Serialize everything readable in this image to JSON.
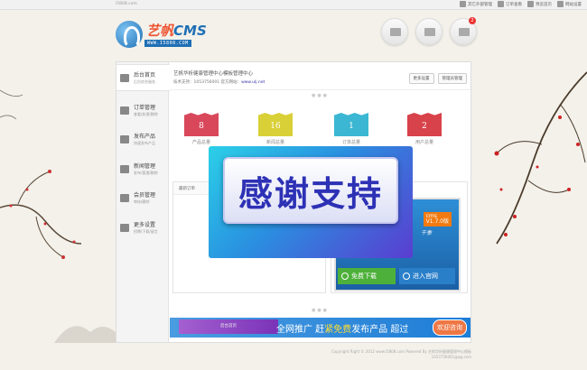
{
  "topbar": {
    "site": "i5808.com",
    "links": [
      {
        "label": "其它外部管理",
        "icon": "document-icon"
      },
      {
        "label": "订单查看",
        "icon": "mail-icon",
        "badge": "8"
      },
      {
        "label": "预览首页",
        "icon": "cloud-icon"
      },
      {
        "label": "网站设置",
        "icon": "gear-icon"
      }
    ]
  },
  "logo": {
    "name_cn": "艺帆",
    "name_en": "CMS",
    "url": "WWW.I5808.COM"
  },
  "header_icons": [
    {
      "icon": "users-icon"
    },
    {
      "icon": "truck-icon"
    },
    {
      "icon": "chat-icon",
      "badge": "2"
    }
  ],
  "sidebar": {
    "items": [
      {
        "label": "后台首页",
        "sub": "后台综合服务",
        "icon": "home-icon"
      },
      {
        "label": "订单管理",
        "sub": "查看/处理/删除",
        "icon": "orders-icon"
      },
      {
        "label": "发布产品",
        "sub": "快速发布产品",
        "icon": "edit-icon"
      },
      {
        "label": "新闻管理",
        "sub": "发布/管理/删除",
        "icon": "news-icon"
      },
      {
        "label": "会员管理",
        "sub": "审核/删除",
        "icon": "members-icon"
      },
      {
        "label": "更多设置",
        "sub": "招聘/下载/留言",
        "icon": "chart-icon"
      }
    ]
  },
  "welcome": {
    "line1": "艺帆华析健康管理中心模板管理中心",
    "line2_prefix": "技术支持：1053756001 官方网站：",
    "line2_link": "www.ulj.net"
  },
  "welcome_buttons": {
    "more": "更多设置",
    "admin": "管理员管理"
  },
  "stats": [
    {
      "value": "8",
      "caption": "产品总量",
      "color": "#d9475a"
    },
    {
      "value": "16",
      "caption": "新闻总量",
      "color": "#d9d038"
    },
    {
      "value": "1",
      "caption": "订单总量",
      "color": "#3cb7d3"
    },
    {
      "value": "2",
      "caption": "用户总量",
      "color": "#d8424a"
    }
  ],
  "panel": {
    "title": "最新订单"
  },
  "promo": {
    "cms": "cms",
    "version": "V1.7.0版",
    "big": "业",
    "script": "千季",
    "download": "免费下载",
    "official": "进入官网"
  },
  "banner": {
    "left": "后台首页",
    "text_a": "全网推广 赶",
    "text_hl": "紧免费",
    "text_b": "发布产品 超过",
    "consult": "欢迎咨询"
  },
  "footer": {
    "line1": "Copyright Right © 2012 www.i5808.com Powered By 艺帆华析健康管理中心模板",
    "line2": "1053756001@qq.com"
  },
  "overlay": {
    "text": "感谢支持"
  }
}
